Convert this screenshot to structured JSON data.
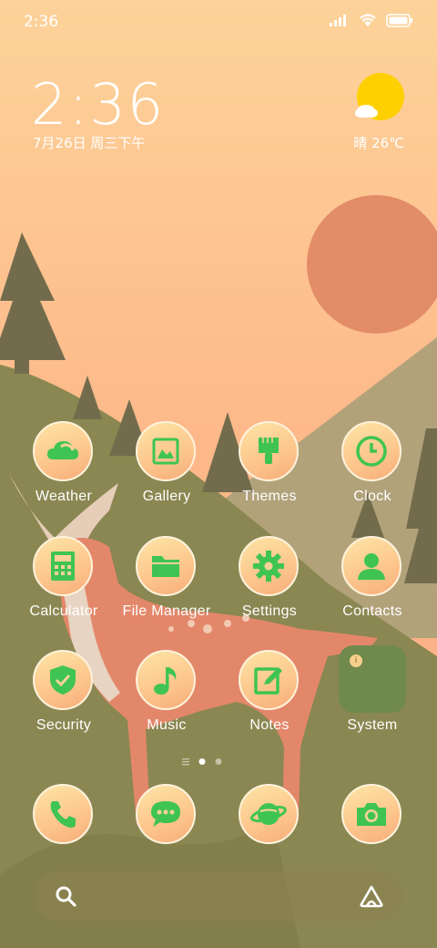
{
  "status_bar": {
    "time": "2:36",
    "icons": [
      "signal-icon",
      "wifi-icon",
      "battery-icon"
    ]
  },
  "lock_widget": {
    "time": "2:36",
    "date": "7月26日 周三下午",
    "weather": "晴 26℃",
    "weather_icon": "sunny-cloud-icon"
  },
  "apps": [
    {
      "label": "Weather",
      "icon": "weather-icon"
    },
    {
      "label": "Gallery",
      "icon": "gallery-icon"
    },
    {
      "label": "Themes",
      "icon": "brush-icon"
    },
    {
      "label": "Clock",
      "icon": "clock-icon"
    },
    {
      "label": "Calculator",
      "icon": "calculator-icon"
    },
    {
      "label": "File Manager",
      "icon": "folder-icon"
    },
    {
      "label": "Settings",
      "icon": "gear-icon"
    },
    {
      "label": "Contacts",
      "icon": "person-icon"
    },
    {
      "label": "Security",
      "icon": "shield-check-icon"
    },
    {
      "label": "Music",
      "icon": "music-note-icon"
    },
    {
      "label": "Notes",
      "icon": "pencil-note-icon"
    },
    {
      "label": "System",
      "icon": "folder-group-icon"
    }
  ],
  "dock": [
    {
      "name": "phone",
      "icon": "phone-icon"
    },
    {
      "name": "messages",
      "icon": "chat-bubble-icon"
    },
    {
      "name": "browser",
      "icon": "planet-icon"
    },
    {
      "name": "camera",
      "icon": "camera-icon"
    }
  ],
  "page_indicator": {
    "pages": 2,
    "current": 1
  },
  "colors": {
    "icon_green": "#3fc453",
    "icon_bg": "#fdd19a",
    "sky_top": "#fdcf97",
    "sun": "#e38d68",
    "ground": "#8a8752"
  }
}
